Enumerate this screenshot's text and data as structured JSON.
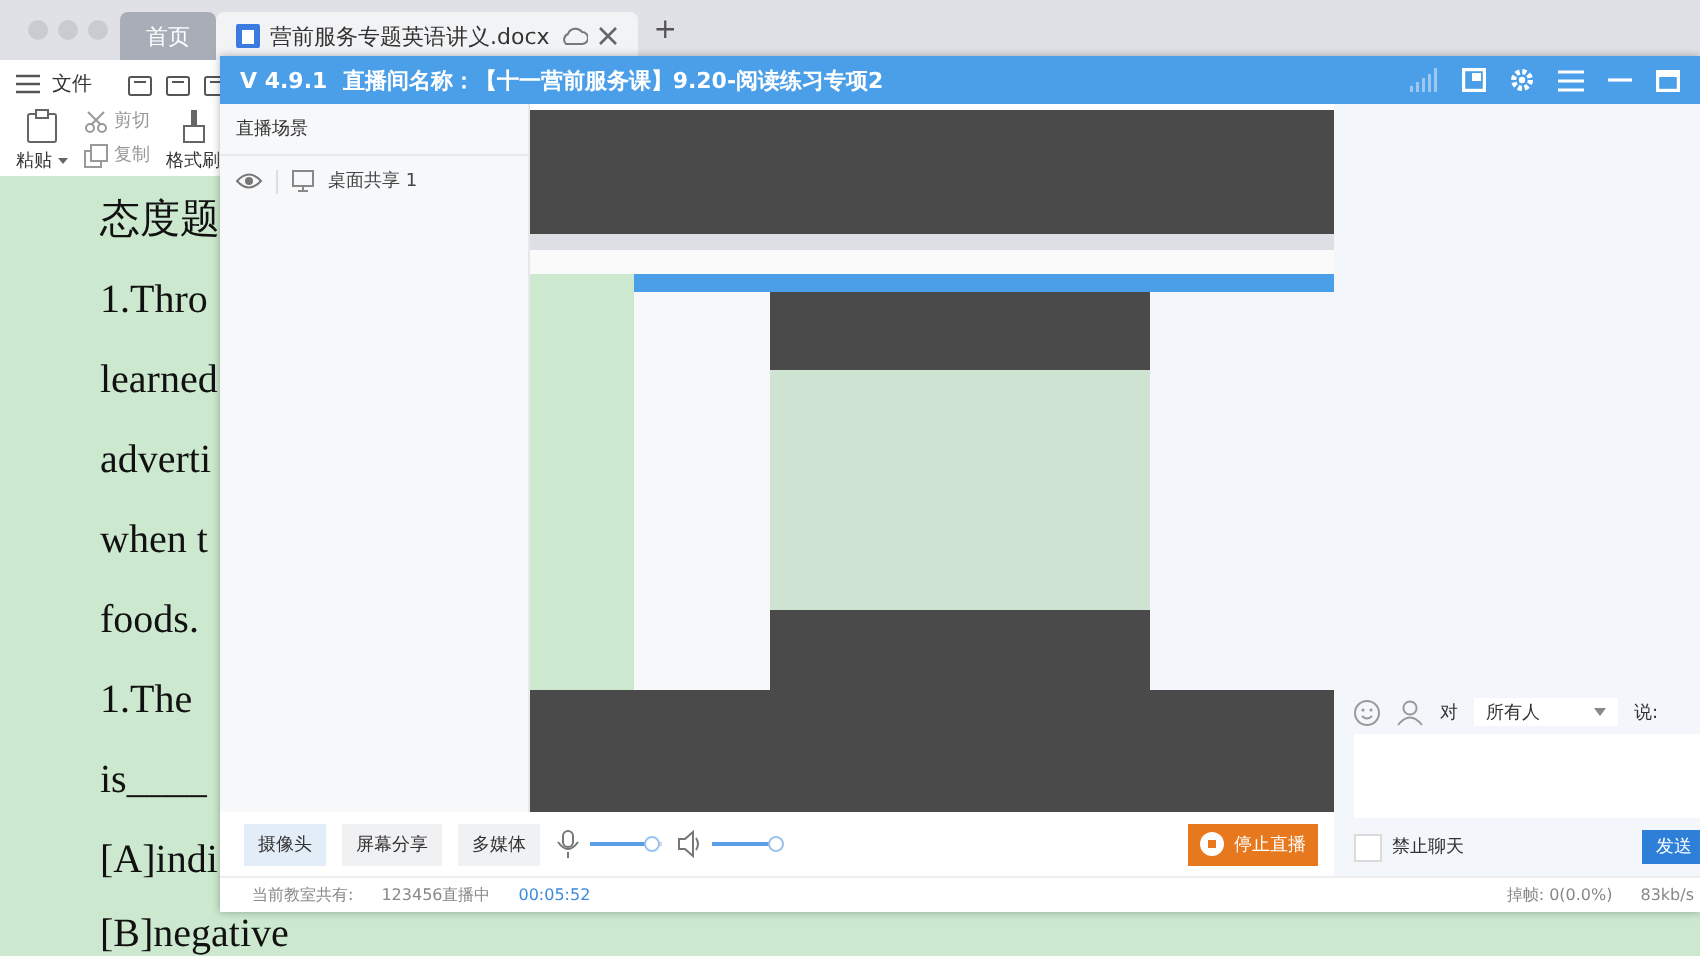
{
  "browser_tabs": [
    {
      "label": "首页",
      "selected": false
    },
    {
      "label": "营前服务专题英语讲义.docx",
      "selected": true
    }
  ],
  "new_tab": "+",
  "toolbar": {
    "menu": "文件",
    "paste": "粘贴",
    "cut": "剪切",
    "copy": "复制",
    "format_painter": "格式刷"
  },
  "document": {
    "lines": [
      "态度题",
      "1.Thro",
      "learned",
      "adverti",
      "when t",
      "foods.",
      "1.The",
      "is____",
      "[A]indi",
      "[B]negative"
    ]
  },
  "live_window": {
    "version": "V 4.9.1",
    "room_label": "直播间名称：",
    "room_name": "【十一营前服务课】9.20-阅读练习专项2",
    "scene_header": "直播场景",
    "scenes": [
      {
        "label": "桌面共享 1"
      }
    ],
    "controls": [
      {
        "label": "摄像头",
        "selected": true
      },
      {
        "label": "屏幕分享",
        "selected": false
      },
      {
        "label": "多媒体",
        "selected": false
      }
    ],
    "mic": {
      "level": 0.85
    },
    "speaker": {
      "level": 0.88
    },
    "stop_button": "停止直播",
    "chat": {
      "to_label": "对",
      "recipient": "所有人",
      "say_label": "说:",
      "mute_all": {
        "label": "禁止聊天",
        "checked": false
      },
      "send_button": "发送"
    },
    "status": {
      "students_label": "当前教室共有:",
      "count": "123456直播中",
      "timer": "00:05:52",
      "dropped": "掉帧: 0(0.0%)",
      "bitrate": "83kb/s"
    }
  }
}
